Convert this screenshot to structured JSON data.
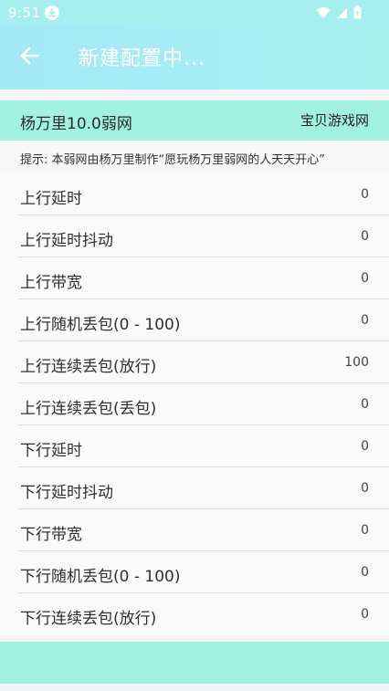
{
  "status_bar": {
    "time": "9:51"
  },
  "app_bar": {
    "title": "新建配置中..."
  },
  "config": {
    "name": "杨万里10.0弱网",
    "site": "宝贝游戏网",
    "hint": "提示: 本弱网由杨万里制作“愿玩杨万里弱网的人天天开心”"
  },
  "settings": [
    {
      "label": "上行延时",
      "value": "0"
    },
    {
      "label": "上行延时抖动",
      "value": "0"
    },
    {
      "label": "上行带宽",
      "value": "0"
    },
    {
      "label": "上行随机丢包(0 - 100)",
      "value": "0"
    },
    {
      "label": "上行连续丢包(放行)",
      "value": "100"
    },
    {
      "label": "上行连续丢包(丢包)",
      "value": "0"
    },
    {
      "label": "下行延时",
      "value": "0"
    },
    {
      "label": "下行延时抖动",
      "value": "0"
    },
    {
      "label": "下行带宽",
      "value": "0"
    },
    {
      "label": "下行随机丢包(0 - 100)",
      "value": "0"
    },
    {
      "label": "下行连续丢包(放行)",
      "value": "0"
    }
  ],
  "colors": {
    "accent": "#a1f3df",
    "app_bar": "#a6eef0"
  }
}
